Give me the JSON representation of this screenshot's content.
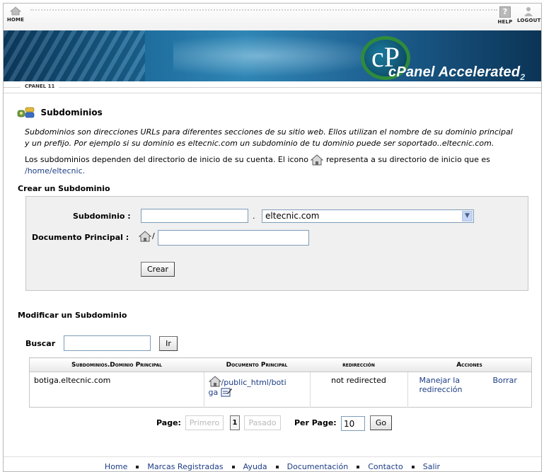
{
  "topbar": {
    "home_label": "HOME",
    "help_label": "HELP",
    "logout_label": "LOGOUT",
    "help_glyph": "?"
  },
  "banner": {
    "logo_mark": "cP",
    "logo_text_c": "cPanel",
    "logo_text_main": " Accelerated",
    "logo_sub": "2"
  },
  "version_tag": "CPANEL 11",
  "page": {
    "title": "Subdominios",
    "intro_line1": "Subdominios son direcciones URLs para diferentes secciones de su sitio web. Ellos utilizan el nombre de su dominio principal",
    "intro_line2": "y un prefijo. Por ejemplo si su dominio es eltecnic.com un subdominio de tu dominio puede ser soportado..eltecnic.com.",
    "home_text_before": "Los subdominios dependen del directorio de inicio de su cuenta. El icono",
    "home_text_after": "representa a su directorio de inicio que es",
    "home_path": "/home/eltecnic."
  },
  "create": {
    "section_title": "Crear un Subdominio",
    "subdomain_label": "Subdominio :",
    "subdomain_value": "",
    "dot": ".",
    "domain_selected": "eltecnic.com",
    "docroot_label": "Documento Principal :",
    "docroot_slash": "/",
    "docroot_value": "",
    "create_button": "Crear"
  },
  "modify": {
    "section_title": "Modificar un Subdominio",
    "search_label": "Buscar",
    "search_value": "",
    "go_button": "Ir",
    "columns": [
      "Subdominios.Dominio Principal",
      "Documento Principal",
      "redirección",
      "Acciones"
    ],
    "rows": [
      {
        "subdomain": "botiga.eltecnic.com",
        "docroot_line1": "/public_html/boti",
        "docroot_line2": "ga",
        "redirect": "not redirected",
        "manage_redirect": "Manejar la redirección",
        "delete": "Borrar"
      }
    ]
  },
  "pager": {
    "page_label": "Page:",
    "first": "Primero",
    "current": "1",
    "last": "Pasado",
    "per_page_label": "Per Page:",
    "per_page_value": "10",
    "go": "Go"
  },
  "footer": {
    "links": [
      "Home",
      "Marcas Registradas",
      "Ayuda",
      "Documentación",
      "Contacto",
      "Salir"
    ]
  },
  "colors": {
    "link": "#1c3d86",
    "banner": "#1d6b9b",
    "panel": "#f0f0f0"
  }
}
